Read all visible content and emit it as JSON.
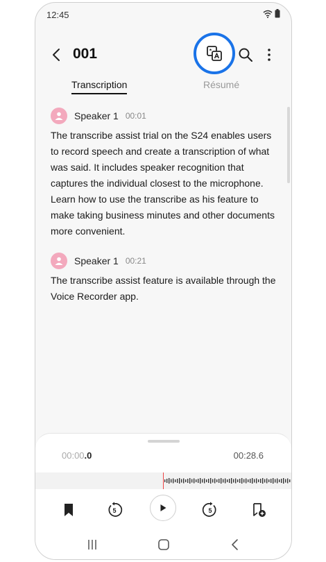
{
  "status_bar": {
    "time": "12:45"
  },
  "app_bar": {
    "title": "001"
  },
  "tabs": [
    {
      "label": "Transcription",
      "active": true
    },
    {
      "label": "Résumé",
      "active": false
    }
  ],
  "transcript": [
    {
      "speaker": "Speaker 1",
      "timestamp": "00:01",
      "text": "The transcribe assist trial on the S24 enables users to record speech and create a transcription of what was said. It includes speaker recognition that captures the individual closest to the microphone. Learn how to use the transcribe as his feature to make taking business minutes and other documents more convenient."
    },
    {
      "speaker": "Speaker 1",
      "timestamp": "00:21",
      "text": "The transcribe assist feature is available through the Voice Recorder app."
    }
  ],
  "player": {
    "current_time_main": "00:00",
    "current_time_fraction": ".0",
    "total_time": "00:28.6",
    "skip_back_seconds": "5",
    "skip_forward_seconds": "5"
  },
  "colors": {
    "highlight_ring": "#1a73e8",
    "avatar": "#f3a9bd",
    "playhead": "#e44444"
  },
  "icons": [
    "back-arrow-icon",
    "translate-icon",
    "search-icon",
    "more-vert-icon",
    "bookmark-icon",
    "rewind-5-icon",
    "play-icon",
    "forward-5-icon",
    "add-bookmark-icon",
    "recents-icon",
    "home-icon",
    "back-nav-icon"
  ]
}
